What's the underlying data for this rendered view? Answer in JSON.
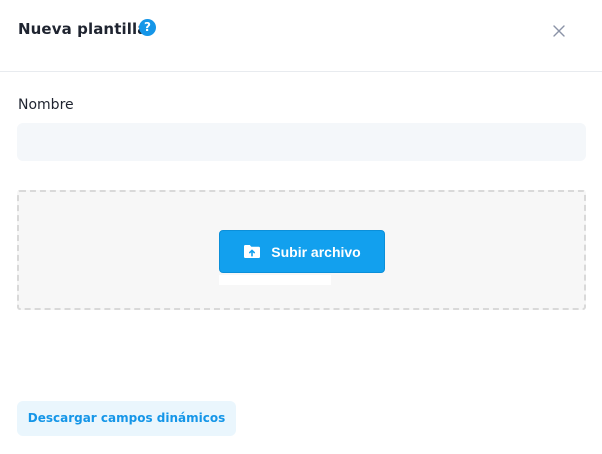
{
  "header": {
    "title": "Nueva plantilla",
    "help_icon": "question-circle-icon",
    "close_icon": "close-icon"
  },
  "form": {
    "name_label": "Nombre",
    "name_value": "",
    "name_placeholder": ""
  },
  "dropzone": {
    "upload_label": "Subir archivo",
    "upload_icon": "folder-upload-icon"
  },
  "footer": {
    "download_label": "Descargar campos dinámicos"
  },
  "colors": {
    "accent": "#12a0ee",
    "help": "#1596e8",
    "input_bg": "#f4f7fa",
    "dropzone_bg": "#f7f7f7",
    "secondary_button_bg": "#eaf6fd"
  }
}
